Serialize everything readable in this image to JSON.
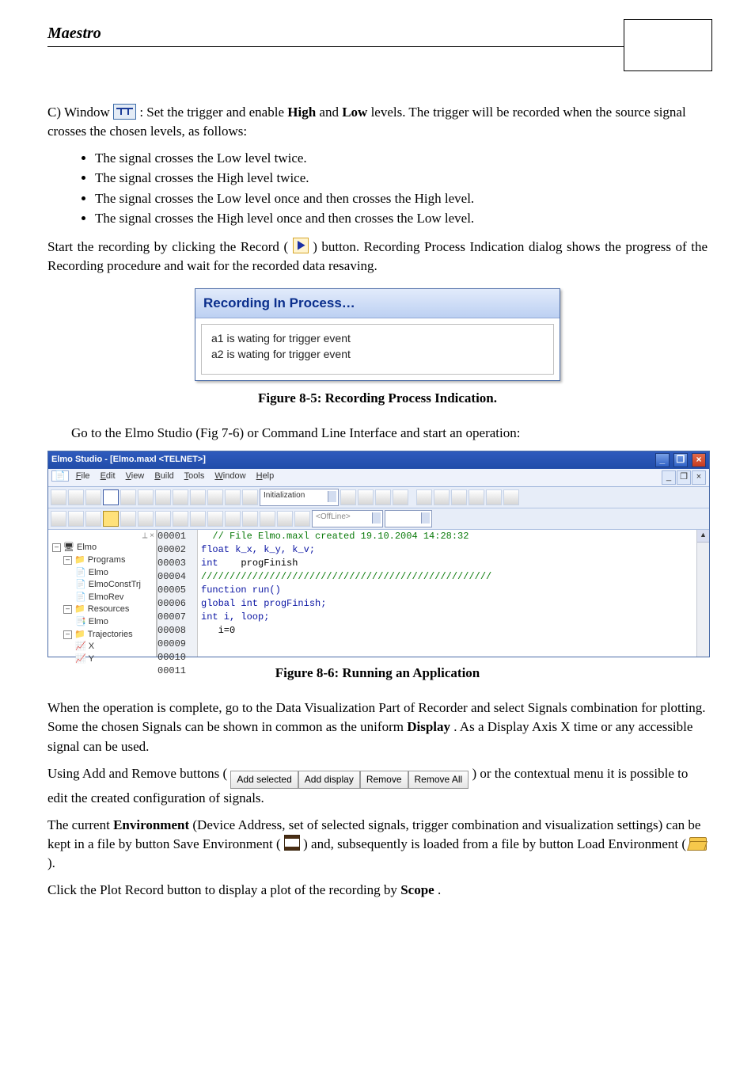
{
  "header": {
    "app_name": "Maestro"
  },
  "intro": {
    "prefix": "C) Window ",
    "suffix": ": Set the trigger and enable ",
    "bold_high": "High",
    "mid": " and ",
    "bold_low": "Low",
    "tail1": " levels. The trigger will be recorded when the source signal crosses the chosen levels, as follows:"
  },
  "bullets": [
    "The signal crosses the Low level twice.",
    "The signal crosses the High level twice.",
    "The signal crosses the Low level once and then crosses the High level.",
    "The signal crosses the High level once and then crosses the Low level."
  ],
  "record_para": {
    "p1": "Start the recording by clicking the Record (",
    "p2": ") button.  Recording Process Indication dialog shows the progress of the Recording procedure and wait for the recorded data resaving."
  },
  "dialog": {
    "title": "Recording In Process…",
    "line1": "a1 is wating for trigger event",
    "line2": "a2 is wating for trigger event"
  },
  "caption1": "Figure 8-5: Recording Process Indication.",
  "goto_line": "Go to the Elmo Studio (Fig 7-6) or Command Line Interface and start an operation:",
  "ide": {
    "title": "Elmo Studio - [Elmo.maxl <TELNET>]",
    "menus": {
      "file": "File",
      "edit": "Edit",
      "view": "View",
      "build": "Build",
      "tools": "Tools",
      "window": "Window",
      "help": "Help"
    },
    "combo1": "Initialization",
    "combo2": "<OffLine>",
    "tree": {
      "root": "Elmo",
      "programs": "Programs",
      "p1": "Elmo",
      "p2": "ElmoConstTrj",
      "p3": "ElmoRev",
      "resources": "Resources",
      "r1": "Elmo",
      "traj": "Trajectories",
      "t1": "X",
      "t2": "Y"
    },
    "code_lines": [
      {
        "n": "00001",
        "cls": "g",
        "txt": "  // File Elmo.maxl created 19.10.2004 14:28:32"
      },
      {
        "n": "00002",
        "cls": "",
        "txt": ""
      },
      {
        "n": "00003",
        "cls": "b",
        "txt": "float k_x, k_y, k_v;"
      },
      {
        "n": "00004",
        "cls": "",
        "txt": "int    progFinish"
      },
      {
        "n": "00005",
        "cls": "",
        "txt": ""
      },
      {
        "n": "00006",
        "cls": "g",
        "txt": "///////////////////////////////////////////////////"
      },
      {
        "n": "00007",
        "cls": "b",
        "txt": "function run()"
      },
      {
        "n": "00008",
        "cls": "b",
        "txt": "global int progFinish;"
      },
      {
        "n": "00009",
        "cls": "b",
        "txt": "int i, loop;"
      },
      {
        "n": "00010",
        "cls": "",
        "txt": ""
      }
    ]
  },
  "caption2": "Figure 8-6: Running an Application",
  "post": {
    "p1": "When the operation is complete, go to the Data Visualization Part of Recorder and select Signals combination for plotting. Some the chosen Signals can be shown in common as the uniform ",
    "disp": "Display",
    "p1b": ". As a Display Axis X time or any accessible signal can be used.",
    "p2a": "Using Add and Remove buttons (",
    "btn_add_sel": "Add selected",
    "btn_add_disp": "Add display",
    "btn_remove": "Remove",
    "btn_remove_all": "Remove All",
    "p2b": ") or the contextual menu it is possible to edit the created configuration of signals.",
    "p3a": "The current ",
    "env": "Environment",
    "p3b": " (Device Address, set of selected signals, trigger combination and visualization settings) can be kept in a file by button Save Environment (",
    "p3c": ") and, subsequently is loaded from a file by button Load Environment (",
    "p3d": ").",
    "p4a": "Click the Plot Record button to display a plot of the recording by ",
    "scope": "Scope",
    "p4b": "."
  }
}
